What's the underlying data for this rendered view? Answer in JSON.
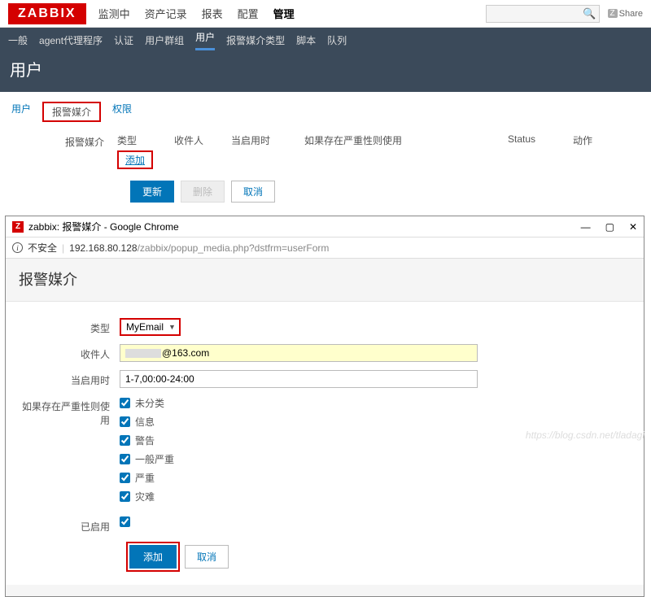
{
  "header": {
    "logo": "ZABBIX",
    "nav": [
      "监测中",
      "资产记录",
      "报表",
      "配置",
      "管理"
    ],
    "active_nav": 4,
    "search_placeholder": "",
    "share_label": "Share",
    "share_badge": "Z"
  },
  "subnav": {
    "items": [
      "一般",
      "agent代理程序",
      "认证",
      "用户群组",
      "用户",
      "报警媒介类型",
      "脚本",
      "队列"
    ],
    "active": 4
  },
  "page_title": "用户",
  "tabs": {
    "items": [
      "用户",
      "报警媒介",
      "权限"
    ],
    "active": 1
  },
  "media_table": {
    "label": "报警媒介",
    "columns": [
      "类型",
      "收件人",
      "当启用时",
      "如果存在严重性则使用",
      "Status",
      "动作"
    ],
    "add_link": "添加"
  },
  "form_buttons": {
    "update": "更新",
    "delete": "删除",
    "cancel": "取消"
  },
  "popup": {
    "window_title": "zabbix: 报警媒介 - Google Chrome",
    "insecure_label": "不安全",
    "url_host": "192.168.80.128",
    "url_path": "/zabbix/popup_media.php?dstfrm=userForm",
    "heading": "报警媒介",
    "fields": {
      "type_label": "类型",
      "type_value": "MyEmail",
      "recipient_label": "收件人",
      "recipient_value": "@163.com",
      "when_label": "当启用时",
      "when_value": "1-7,00:00-24:00",
      "severity_label": "如果存在严重性则使用",
      "severities": [
        "未分类",
        "信息",
        "警告",
        "一般严重",
        "严重",
        "灾难"
      ],
      "enabled_label": "已启用"
    },
    "buttons": {
      "add": "添加",
      "cancel": "取消"
    }
  },
  "watermark": "https://blog.csdn.net/tladagi"
}
